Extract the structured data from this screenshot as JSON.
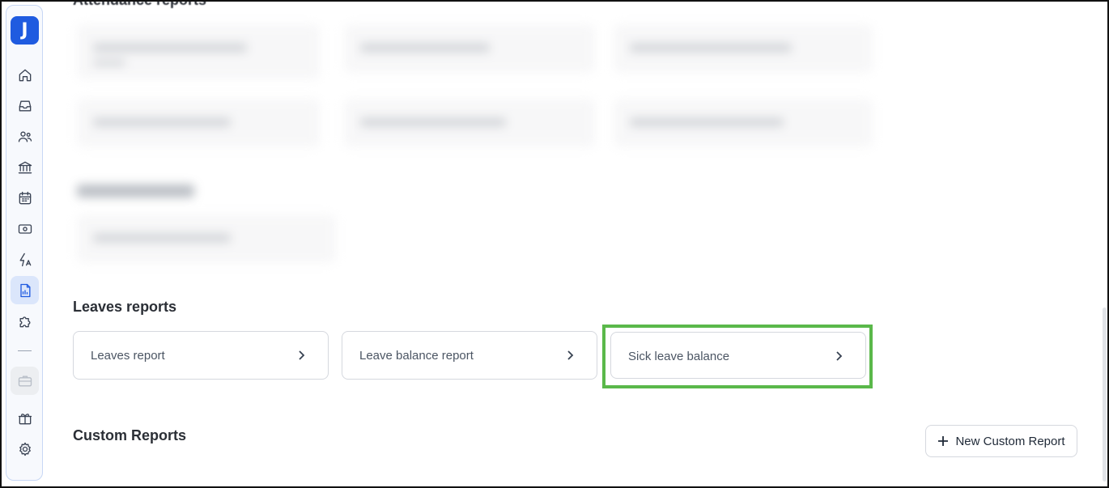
{
  "sidebar": {
    "logo": "J",
    "items": [
      {
        "name": "home-icon"
      },
      {
        "name": "inbox-icon"
      },
      {
        "name": "people-icon"
      },
      {
        "name": "bank-icon"
      },
      {
        "name": "calendar-icon"
      },
      {
        "name": "money-icon"
      },
      {
        "name": "automation-icon"
      },
      {
        "name": "reports-icon",
        "active": true
      },
      {
        "name": "puzzle-icon"
      },
      {
        "name": "briefcase-icon",
        "muted": true
      },
      {
        "name": "gift-icon"
      },
      {
        "name": "gear-icon"
      }
    ]
  },
  "sections": {
    "attendance_title": "Attendance reports",
    "leaves_title": "Leaves reports",
    "custom_title": "Custom Reports"
  },
  "leaves_reports": [
    {
      "label": "Leaves report"
    },
    {
      "label": "Leave balance report"
    },
    {
      "label": "Sick leave balance"
    }
  ],
  "custom": {
    "new_button": "New Custom Report"
  },
  "colors": {
    "accent": "#1f5be0",
    "highlight": "#5ab84a"
  }
}
